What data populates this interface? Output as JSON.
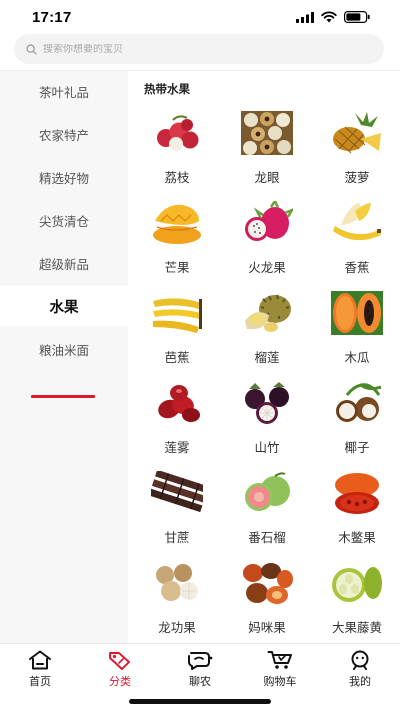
{
  "status": {
    "time": "17:17"
  },
  "search": {
    "placeholder": "搜索你想要的宝贝"
  },
  "sidebar": {
    "items": [
      {
        "label": "茶叶礼品"
      },
      {
        "label": "农家特产"
      },
      {
        "label": "精选好物"
      },
      {
        "label": "尖货清仓"
      },
      {
        "label": "超级新品"
      },
      {
        "label": "水果",
        "active": true
      },
      {
        "label": "粮油米面"
      }
    ]
  },
  "content": {
    "section_title": "热带水果",
    "fruits": [
      {
        "name": "荔枝",
        "icon": "lychee-icon"
      },
      {
        "name": "龙眼",
        "icon": "longan-icon"
      },
      {
        "name": "菠萝",
        "icon": "pineapple-icon"
      },
      {
        "name": "芒果",
        "icon": "mango-icon"
      },
      {
        "name": "火龙果",
        "icon": "dragonfruit-icon"
      },
      {
        "name": "香蕉",
        "icon": "banana-icon"
      },
      {
        "name": "芭蕉",
        "icon": "plantain-icon"
      },
      {
        "name": "榴莲",
        "icon": "durian-icon"
      },
      {
        "name": "木瓜",
        "icon": "papaya-icon"
      },
      {
        "name": "莲雾",
        "icon": "wax-apple-icon"
      },
      {
        "name": "山竹",
        "icon": "mangosteen-icon"
      },
      {
        "name": "椰子",
        "icon": "coconut-icon"
      },
      {
        "name": "甘蔗",
        "icon": "sugarcane-icon"
      },
      {
        "name": "番石榴",
        "icon": "guava-icon"
      },
      {
        "name": "木鳖果",
        "icon": "gac-fruit-icon"
      },
      {
        "name": "龙功果",
        "icon": "longgong-fruit-icon"
      },
      {
        "name": "妈咪果",
        "icon": "mommy-fruit-icon"
      },
      {
        "name": "大果藤黄",
        "icon": "garcinia-icon"
      }
    ]
  },
  "tabbar": {
    "items": [
      {
        "label": "首页",
        "icon": "home-icon"
      },
      {
        "label": "分类",
        "icon": "category-tag-icon",
        "active": true
      },
      {
        "label": "聊农",
        "icon": "chat-icon"
      },
      {
        "label": "购物车",
        "icon": "cart-icon"
      },
      {
        "label": "我的",
        "icon": "profile-icon"
      }
    ]
  },
  "colors": {
    "accent": "#e0162b",
    "sidebar_bg": "#f7f7f7",
    "search_bg": "#f3f3f3"
  }
}
